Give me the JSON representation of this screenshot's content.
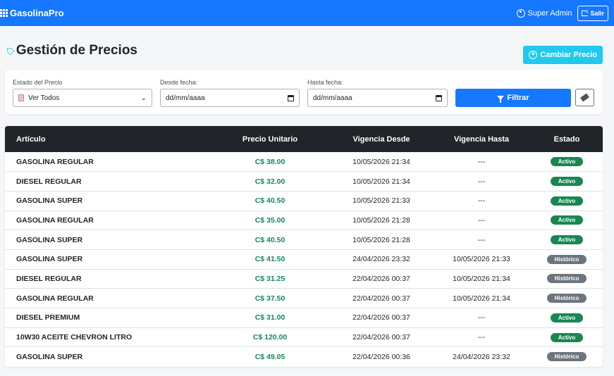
{
  "navbar": {
    "brand": "GasolinaPro",
    "user": "Super Admin",
    "logout_label": "Salir"
  },
  "header": {
    "title": "Gestión de Precios",
    "change_price_label": "Cambiar Precio"
  },
  "filters": {
    "status_label": "Estado del Precio",
    "status_value": "Ver Todos",
    "from_label": "Desde fecha:",
    "from_value": "dd/mm/aaaa",
    "to_label": "Hasta fecha:",
    "to_value": "dd/mm/aaaa",
    "filter_label": "Filtrar"
  },
  "table": {
    "columns": [
      "Artículo",
      "Precio Unitario",
      "Vigencia Desde",
      "Vigencia Hasta",
      "Estado"
    ],
    "rows": [
      {
        "articulo": "GASOLINA REGULAR",
        "precio": "C$ 38.00",
        "desde": "10/05/2026 21:34",
        "hasta": "---",
        "estado": "Activo",
        "tipo": "activo"
      },
      {
        "articulo": "DIESEL REGULAR",
        "precio": "C$ 32.00",
        "desde": "10/05/2026 21:34",
        "hasta": "---",
        "estado": "Activo",
        "tipo": "activo"
      },
      {
        "articulo": "GASOLINA SUPER",
        "precio": "C$ 40.50",
        "desde": "10/05/2026 21:33",
        "hasta": "---",
        "estado": "Activo",
        "tipo": "activo"
      },
      {
        "articulo": "GASOLINA REGULAR",
        "precio": "C$ 35.00",
        "desde": "10/05/2026 21:28",
        "hasta": "---",
        "estado": "Activo",
        "tipo": "activo"
      },
      {
        "articulo": "GASOLINA SUPER",
        "precio": "C$ 40.50",
        "desde": "10/05/2026 21:28",
        "hasta": "---",
        "estado": "Activo",
        "tipo": "activo"
      },
      {
        "articulo": "GASOLINA SUPER",
        "precio": "C$ 41.50",
        "desde": "24/04/2026 23:32",
        "hasta": "10/05/2026 21:33",
        "estado": "Histórico",
        "tipo": "historico"
      },
      {
        "articulo": "DIESEL REGULAR",
        "precio": "C$ 31.25",
        "desde": "22/04/2026 00:37",
        "hasta": "10/05/2026 21:34",
        "estado": "Histórico",
        "tipo": "historico"
      },
      {
        "articulo": "GASOLINA REGULAR",
        "precio": "C$ 37.50",
        "desde": "22/04/2026 00:37",
        "hasta": "10/05/2026 21:34",
        "estado": "Histórico",
        "tipo": "historico"
      },
      {
        "articulo": "DIESEL PREMIUM",
        "precio": "C$ 31.00",
        "desde": "22/04/2026 00:37",
        "hasta": "---",
        "estado": "Activo",
        "tipo": "activo"
      },
      {
        "articulo": "10W30 ACEITE CHEVRON LITRO",
        "precio": "C$ 120.00",
        "desde": "22/04/2026 00:37",
        "hasta": "---",
        "estado": "Activo",
        "tipo": "activo"
      },
      {
        "articulo": "GASOLINA SUPER",
        "precio": "C$ 49.05",
        "desde": "22/04/2026 00:36",
        "hasta": "24/04/2026 23:32",
        "estado": "Histórico",
        "tipo": "historico"
      }
    ]
  },
  "colors": {
    "primary": "#1677ff",
    "info": "#21c9ef",
    "success": "#198754",
    "secondary": "#6c757d",
    "dark": "#212529"
  }
}
